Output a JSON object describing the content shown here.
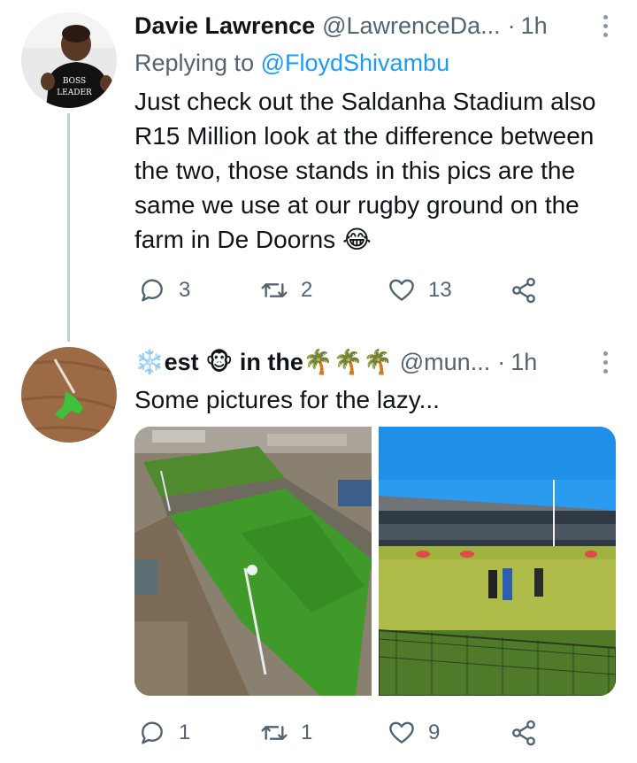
{
  "tweets": [
    {
      "name": "Davie Lawrence",
      "handle": "@LawrenceDa...",
      "dot": "·",
      "time": "1h",
      "replying_prefix": "Replying to ",
      "replying_to": "@FloydShivambu",
      "text": "Just check out the Saldanha Stadium also R15 Million look at the difference between the two, those stands in this pics are the same we use at our rugby ground on the farm in De Doorns 😂",
      "avatar_text": [
        "BOSS",
        "LEADER"
      ],
      "actions": {
        "replies": "3",
        "retweets": "2",
        "likes": "13"
      }
    },
    {
      "name_parts": [
        "❄️",
        "est",
        "🐵",
        "in the",
        "🌴🌴🌴"
      ],
      "handle": "@mun...",
      "dot": "·",
      "time": "1h",
      "text": "Some pictures for the lazy...",
      "actions": {
        "replies": "1",
        "retweets": "1",
        "likes": "9"
      }
    }
  ],
  "icons": {
    "reply": "reply-icon",
    "retweet": "retweet-icon",
    "like": "heart-icon",
    "share": "share-icon",
    "more": "more-vertical-icon"
  },
  "colors": {
    "text": "#0f1419",
    "secondary": "#536471",
    "link": "#1d9bf0",
    "thread_line": "#c4cfd6"
  }
}
